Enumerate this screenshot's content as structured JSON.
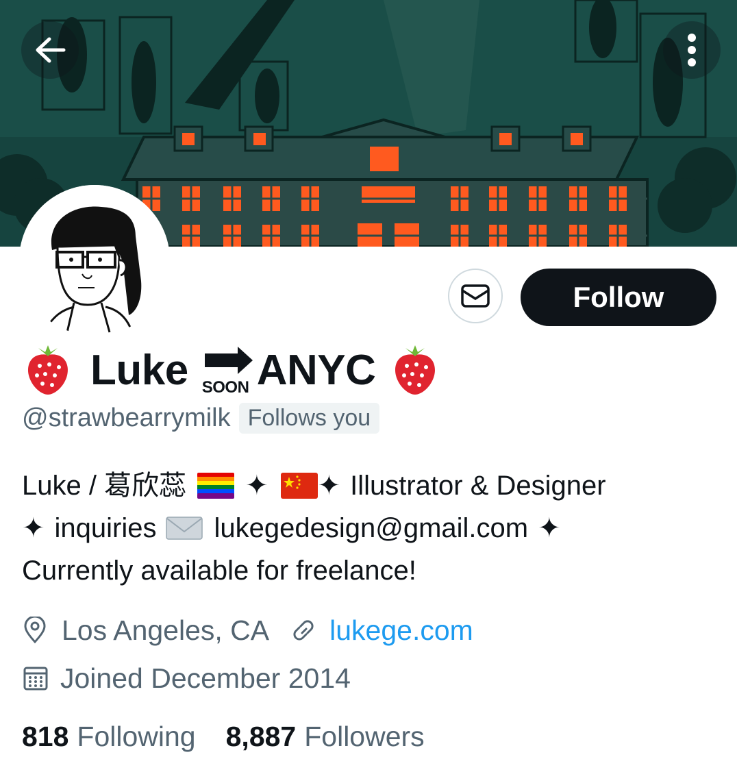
{
  "profile": {
    "name_start": "Luke",
    "name_soon": "SOON",
    "name_end": "ANYC",
    "handle": "@strawbearrymilk",
    "follows_you": "Follows you"
  },
  "actions": {
    "follow_label": "Follow"
  },
  "bio": {
    "line1_a": "Luke / 葛欣蕊",
    "line1_b": "Illustrator & Designer",
    "line2_a": "inquiries",
    "line2_b": "lukegedesign@gmail.com",
    "line3": "Currently available for freelance!",
    "sparkle": "✦"
  },
  "meta": {
    "location": "Los Angeles, CA",
    "website": "lukege.com",
    "joined": "Joined December 2014"
  },
  "stats": {
    "following_count": "818",
    "following_label": "Following",
    "followers_count": "8,887",
    "followers_label": "Followers"
  },
  "icons": [
    "back-arrow-icon",
    "more-vertical-icon",
    "mail-icon",
    "location-pin-icon",
    "link-icon",
    "calendar-icon",
    "strawberry-icon",
    "rainbow-flag-icon",
    "china-flag-icon",
    "envelope-emoji-icon",
    "soon-arrow-icon"
  ],
  "colors": {
    "banner_bg": "#16443f",
    "window_orange": "#ff5a1f",
    "text_primary": "#0f1419",
    "text_secondary": "#536471",
    "link": "#1d9bf0",
    "follow_button": "#0f1419"
  }
}
